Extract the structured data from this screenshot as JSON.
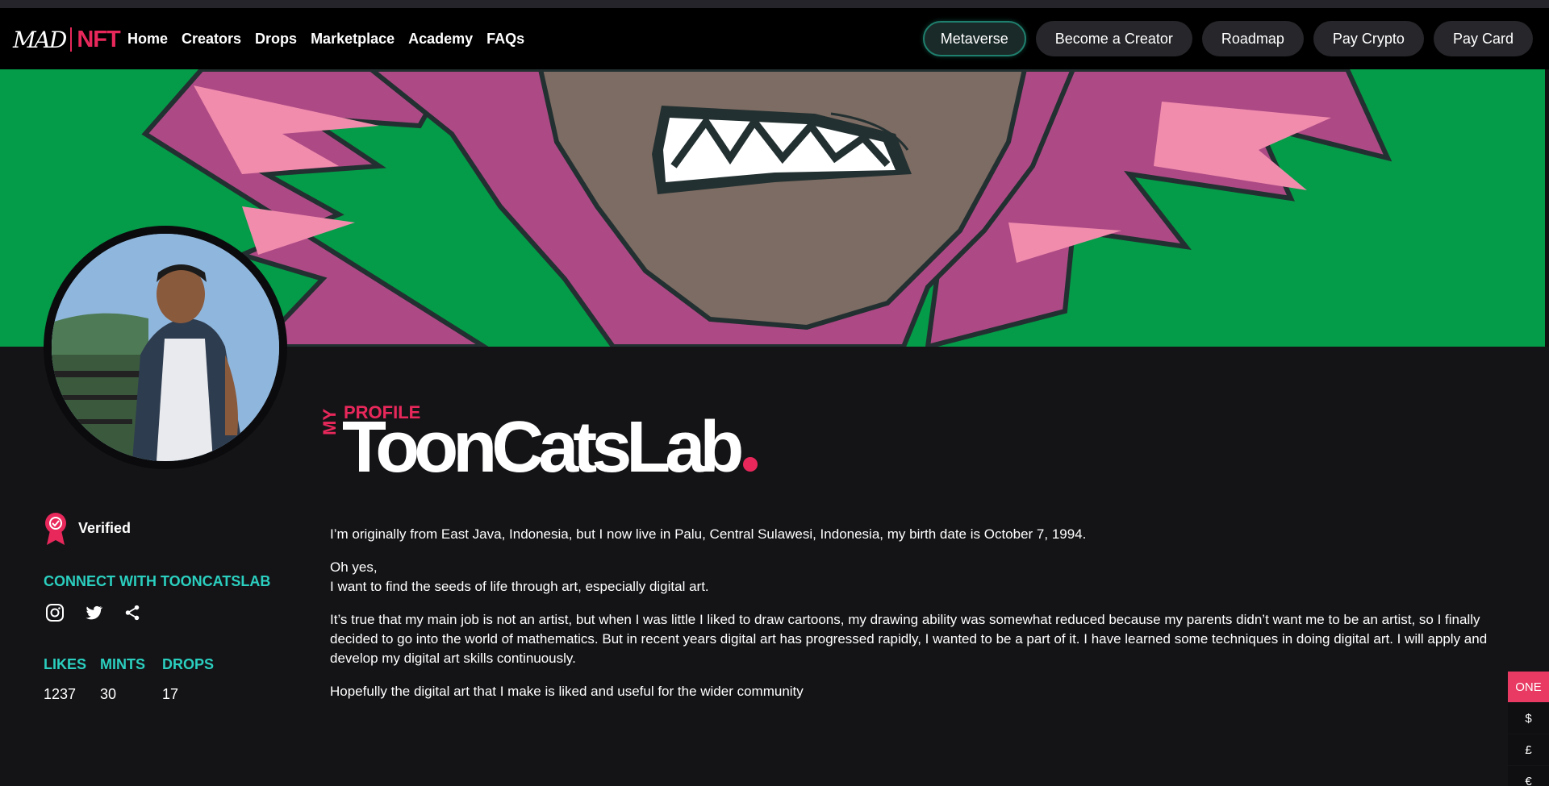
{
  "brand": {
    "logo_left": "MAD",
    "logo_right": "NFT"
  },
  "nav": {
    "links": [
      "Home",
      "Creators",
      "Drops",
      "Marketplace",
      "Academy",
      "FAQs"
    ],
    "buttons": [
      "Metaverse",
      "Become a Creator",
      "Roadmap",
      "Pay Crypto",
      "Pay Card"
    ]
  },
  "profile": {
    "pre_label": "PROFILE",
    "side_label": "MY",
    "name": "ToonCatsLab",
    "verified_label": "Verified",
    "connect_label": "CONNECT WITH TOONCATSLAB",
    "socials": [
      "instagram-icon",
      "twitter-icon",
      "share-icon"
    ],
    "stats": [
      {
        "label": "LIKES",
        "value": "1237"
      },
      {
        "label": "MINTS",
        "value": "30"
      },
      {
        "label": "DROPS",
        "value": "17"
      }
    ],
    "bio": [
      "I’m originally from East Java, Indonesia, but I now live in Palu, Central Sulawesi, Indonesia, my birth date is October 7, 1994.",
      "Oh yes,",
      "I want to find the seeds of life through art, especially digital art.",
      "It’s true that my main job is not an artist, but when I was little I liked to draw cartoons, my drawing ability was somewhat reduced because my parents didn’t want me to be an artist, so I finally decided to go into the world of mathematics. But in recent years digital art has progressed rapidly, I wanted to be a part of it. I have learned some techniques in doing digital art. I will apply and develop my digital art skills continuously.",
      "Hopefully the digital art that I make is liked and useful for the wider community"
    ]
  },
  "currency": {
    "options": [
      "ONE",
      "$",
      "£",
      "€"
    ],
    "selected": "ONE"
  },
  "colors": {
    "accent": "#e8285b",
    "teal": "#2bcfbf",
    "banner_bg": "#049c48",
    "page_bg": "#141417"
  }
}
